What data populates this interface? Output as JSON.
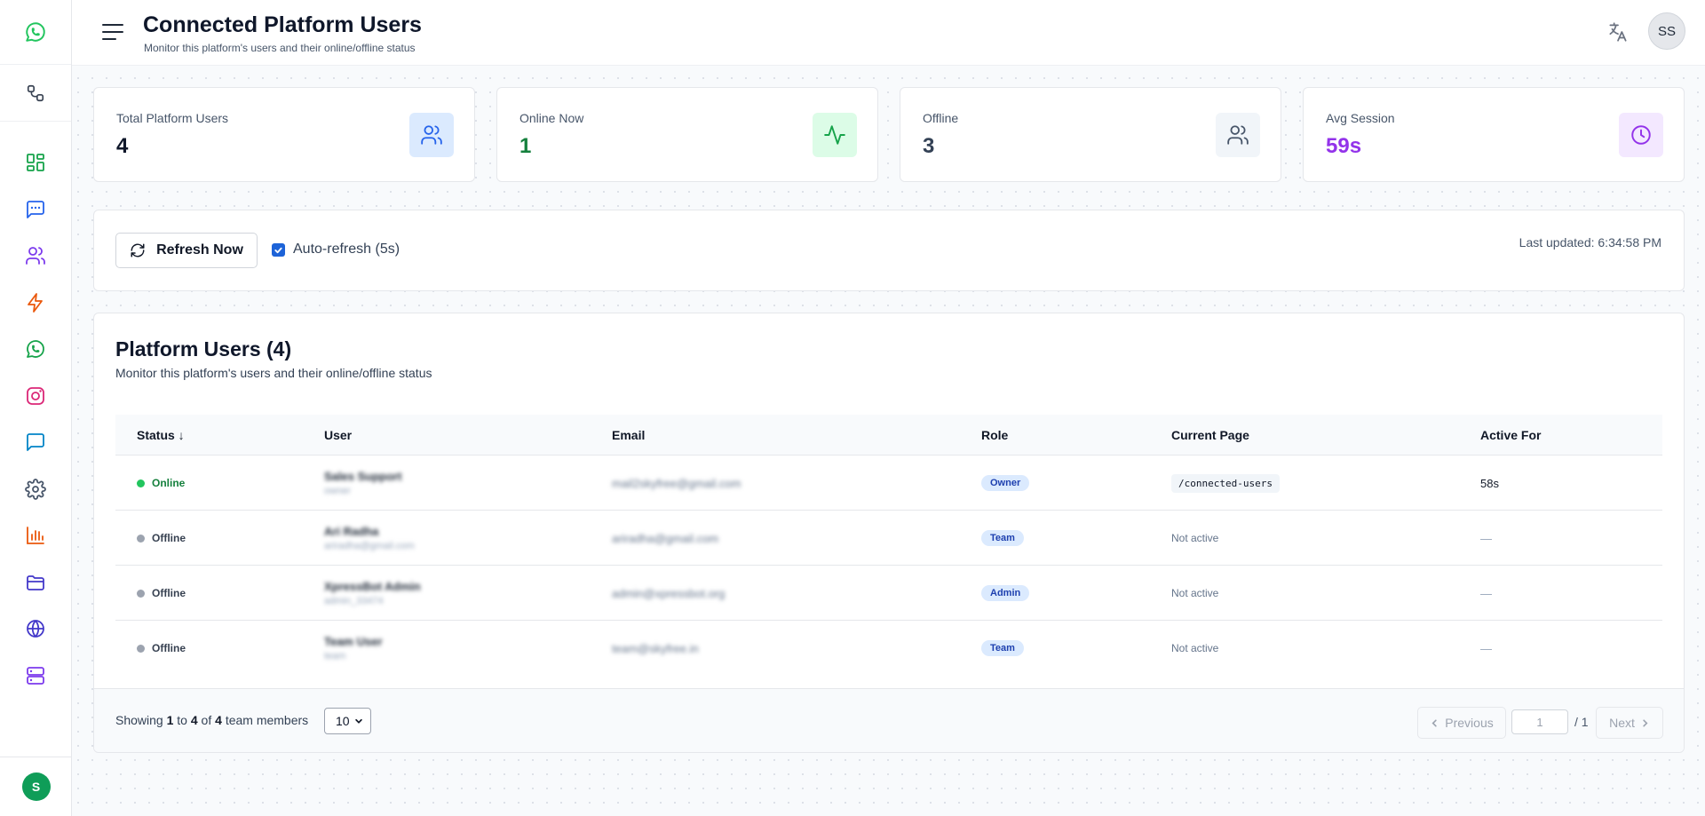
{
  "header": {
    "title": "Connected Platform Users",
    "subtitle": "Monitor this platform's users and their online/offline status",
    "avatar_initials": "SS"
  },
  "sidebar": {
    "user_initial": "S",
    "items": [
      {
        "icon": "dashboard-icon",
        "color": "#16a34a"
      },
      {
        "icon": "message-square-icon",
        "color": "#2563eb"
      },
      {
        "icon": "users-icon",
        "color": "#7c3aed"
      },
      {
        "icon": "lightning-icon",
        "color": "#ea580c"
      },
      {
        "icon": "whatsapp-icon",
        "color": "#16a34a"
      },
      {
        "icon": "instagram-icon",
        "color": "#db2777"
      },
      {
        "icon": "chat-icon",
        "color": "#0284c7"
      },
      {
        "icon": "settings-icon",
        "color": "#475569"
      },
      {
        "icon": "bar-chart-icon",
        "color": "#ea580c"
      },
      {
        "icon": "folder-icon",
        "color": "#4338ca"
      },
      {
        "icon": "globe-icon",
        "color": "#4338ca"
      },
      {
        "icon": "server-icon",
        "color": "#7c3aed"
      }
    ]
  },
  "stats": [
    {
      "label": "Total Platform Users",
      "value": "4",
      "color": "#0f172a",
      "icon": "users-icon",
      "icon_bg": "#dbeafe",
      "icon_color": "#2563eb"
    },
    {
      "label": "Online Now",
      "value": "1",
      "color": "#15803d",
      "icon": "activity-icon",
      "icon_bg": "#dcfce7",
      "icon_color": "#16a34a"
    },
    {
      "label": "Offline",
      "value": "3",
      "color": "#334155",
      "icon": "users-icon",
      "icon_bg": "#f1f5f9",
      "icon_color": "#475569"
    },
    {
      "label": "Avg Session",
      "value": "59s",
      "color": "#9333ea",
      "icon": "clock-icon",
      "icon_bg": "#f3e8ff",
      "icon_color": "#9333ea"
    }
  ],
  "toolbar": {
    "refresh_label": "Refresh Now",
    "auto_refresh_label": "Auto-refresh (5s)",
    "last_updated": "Last updated: 6:34:58 PM"
  },
  "users": {
    "title": "Platform Users (4)",
    "subtitle": "Monitor this platform's users and their online/offline status",
    "columns": [
      "Status ↓",
      "User",
      "Email",
      "Role",
      "Current Page",
      "Active For"
    ],
    "rows": [
      {
        "status": "Online",
        "name": "Sales Support",
        "sub": "owner",
        "email": "mail2skyfree@gmail.com",
        "role": "Owner",
        "page": "/connected-users",
        "active": "58s"
      },
      {
        "status": "Offline",
        "name": "Ari Radha",
        "sub": "ariradha@gmail.com",
        "email": "ariradha@gmail.com",
        "role": "Team",
        "page": "Not active",
        "active": "—"
      },
      {
        "status": "Offline",
        "name": "XpressBot Admin",
        "sub": "admin_33474",
        "email": "admin@xpressbot.org",
        "role": "Admin",
        "page": "Not active",
        "active": "—"
      },
      {
        "status": "Offline",
        "name": "Team User",
        "sub": "team",
        "email": "team@skyfree.in",
        "role": "Team",
        "page": "Not active",
        "active": "—"
      }
    ]
  },
  "footer": {
    "showing_prefix": "Showing",
    "from": "1",
    "to_word": "to",
    "to": "4",
    "of_word": "of",
    "total": "4",
    "suffix": "team members",
    "per_page": "10",
    "previous": "Previous",
    "page_value": "1",
    "page_total": "/ 1",
    "next": "Next"
  }
}
